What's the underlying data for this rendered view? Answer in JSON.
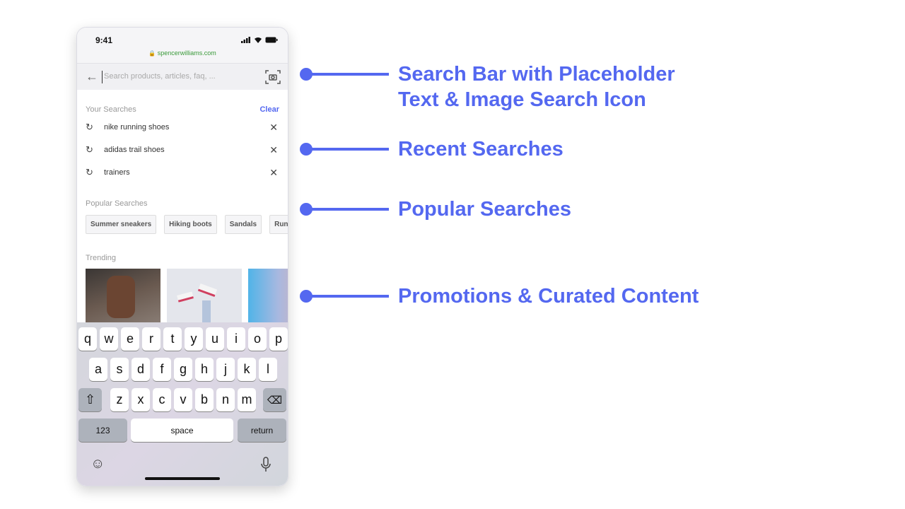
{
  "status_bar": {
    "time": "9:41",
    "url": "spencerwilliams.com"
  },
  "search": {
    "placeholder": "Search products, articles, faq, ..."
  },
  "recent": {
    "label": "Your Searches",
    "clear": "Clear",
    "items": [
      "nike running shoes",
      "adidas trail shoes",
      "trainers"
    ]
  },
  "popular": {
    "label": "Popular Searches",
    "chips": [
      "Summer sneakers",
      "Hiking boots",
      "Sandals",
      "Running shoes"
    ]
  },
  "trending": {
    "label": "Trending"
  },
  "keyboard": {
    "row1": [
      "q",
      "w",
      "e",
      "r",
      "t",
      "y",
      "u",
      "i",
      "o",
      "p"
    ],
    "row2": [
      "a",
      "s",
      "d",
      "f",
      "g",
      "h",
      "j",
      "k",
      "l"
    ],
    "row3": [
      "z",
      "x",
      "c",
      "v",
      "b",
      "n",
      "m"
    ],
    "numbers": "123",
    "space": "space",
    "return": "return"
  },
  "annotations": [
    "Search Bar with Placeholder\nText & Image Search Icon",
    "Recent Searches",
    "Popular Searches",
    "Promotions & Curated Content"
  ],
  "accent": "#5468f0"
}
